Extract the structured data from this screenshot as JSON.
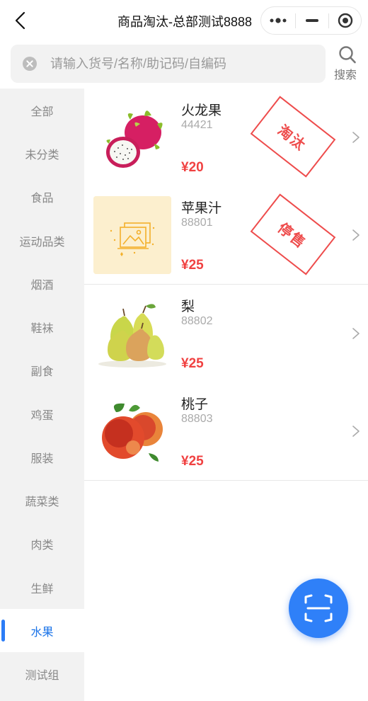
{
  "header": {
    "title": "商品淘汰-总部测试8888",
    "back_icon": "chevron-left-icon",
    "capsule_icons": [
      "more-dots-icon",
      "minimize-icon",
      "close-circle-icon"
    ]
  },
  "search": {
    "placeholder": "请输入货号/名称/助记码/自编码",
    "value": "",
    "button_label": "搜索",
    "clear_icon": "clear-circle-icon",
    "search_icon": "magnifier-icon"
  },
  "sidebar": {
    "items": [
      {
        "label": "全部"
      },
      {
        "label": "未分类"
      },
      {
        "label": "食品"
      },
      {
        "label": "运动品类"
      },
      {
        "label": "烟酒"
      },
      {
        "label": "鞋袜"
      },
      {
        "label": "副食"
      },
      {
        "label": "鸡蛋"
      },
      {
        "label": "服装"
      },
      {
        "label": "蔬菜类"
      },
      {
        "label": "肉类"
      },
      {
        "label": "生鲜"
      },
      {
        "label": "水果"
      },
      {
        "label": "测试组"
      }
    ],
    "selected": "水果"
  },
  "products": [
    {
      "name": "火龙果",
      "code": "44421",
      "price": "¥20",
      "stamp": "淘汰",
      "image": "dragon-fruit-image"
    },
    {
      "name": "苹果汁",
      "code": "88801",
      "price": "¥25",
      "stamp": "停售",
      "image": "placeholder-image-icon"
    },
    {
      "name": "梨",
      "code": "88802",
      "price": "¥25",
      "stamp": "",
      "image": "pear-image"
    },
    {
      "name": "桃子",
      "code": "88803",
      "price": "¥25",
      "stamp": "",
      "image": "peach-image"
    }
  ],
  "fab": {
    "icon": "scan-icon"
  },
  "colors": {
    "accent": "#2f80f8",
    "price": "#f04141",
    "stamp": "#ee4c4c",
    "active_text": "#1a73e8"
  }
}
